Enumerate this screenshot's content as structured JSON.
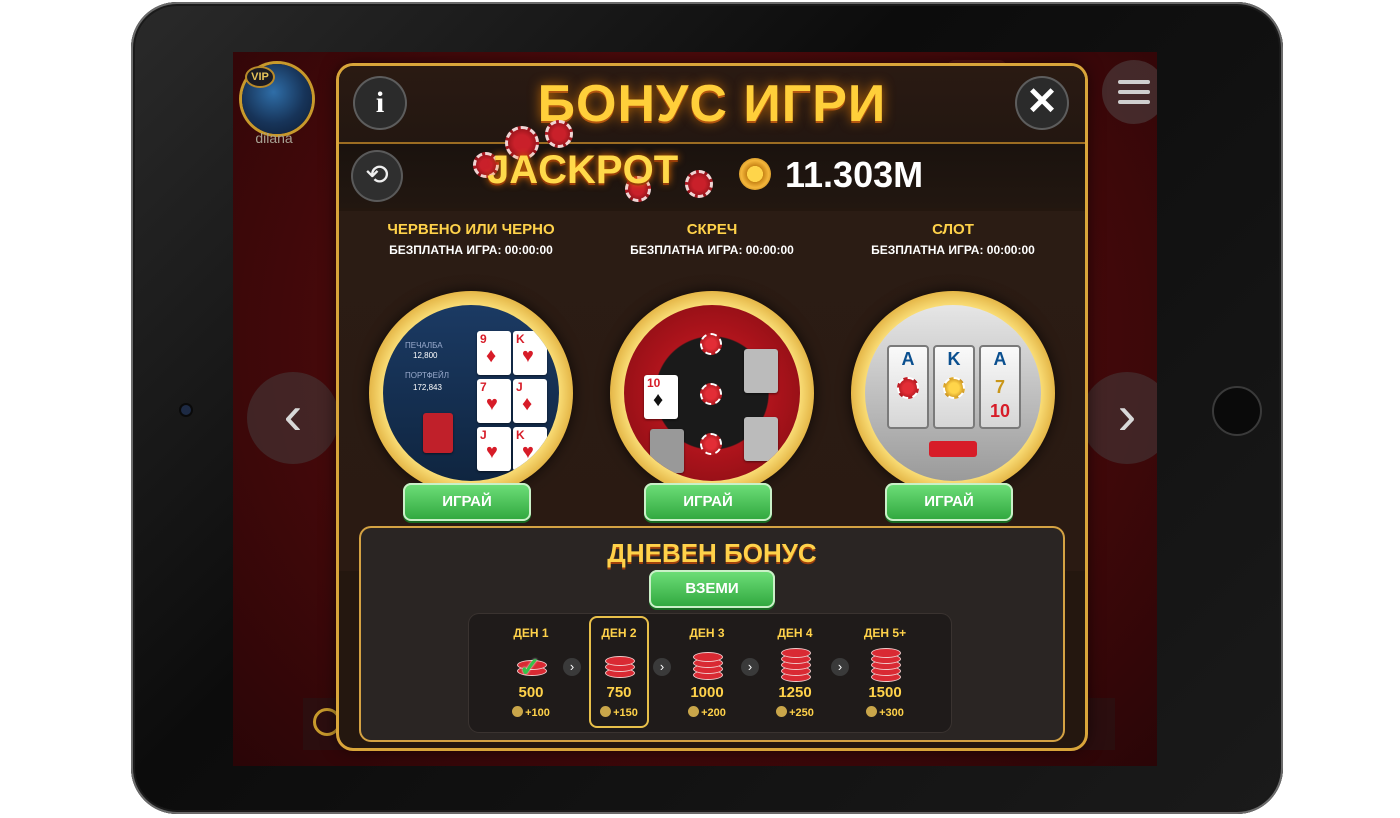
{
  "background": {
    "username": "dilana",
    "vip_badge": "VIP"
  },
  "popup": {
    "title": "БОНУС ИГРИ",
    "info_icon": "i",
    "close_icon": "✕",
    "jackpot_label": "JACKPOT",
    "jackpot_amount": "11.303M"
  },
  "games": [
    {
      "title": "ЧЕРВЕНО ИЛИ ЧЕРНО",
      "subtitle": "БЕЗПЛАТНА ИГРА: 00:00:00",
      "play_label": "ИГРАЙ",
      "art": {
        "win_label": "ПЕЧАЛБА",
        "win_value": "12,800",
        "wallet_label": "ПОРТФЕЙЛ",
        "wallet_value": "172,843"
      }
    },
    {
      "title": "СКРЕЧ",
      "subtitle": "БЕЗПЛАТНА ИГРА: 00:00:00",
      "play_label": "ИГРАЙ"
    },
    {
      "title": "СЛОТ",
      "subtitle": "БЕЗПЛАТНА ИГРА: 00:00:00",
      "play_label": "ИГРАЙ"
    }
  ],
  "daily_bonus": {
    "title": "ДНЕВЕН БОНУС",
    "take_label": "ВЗЕМИ",
    "days": [
      {
        "label": "ДЕН 1",
        "amount": "500",
        "vip": "+100",
        "claimed": true
      },
      {
        "label": "ДЕН 2",
        "amount": "750",
        "vip": "+150",
        "current": true
      },
      {
        "label": "ДЕН 3",
        "amount": "1000",
        "vip": "+200"
      },
      {
        "label": "ДЕН 4",
        "amount": "1250",
        "vip": "+250"
      },
      {
        "label": "ДЕН 5+",
        "amount": "1500",
        "vip": "+300"
      }
    ]
  },
  "colors": {
    "accent_gold": "#ffd24a",
    "play_green": "#2fa63d",
    "chip_red": "#d92a33"
  }
}
